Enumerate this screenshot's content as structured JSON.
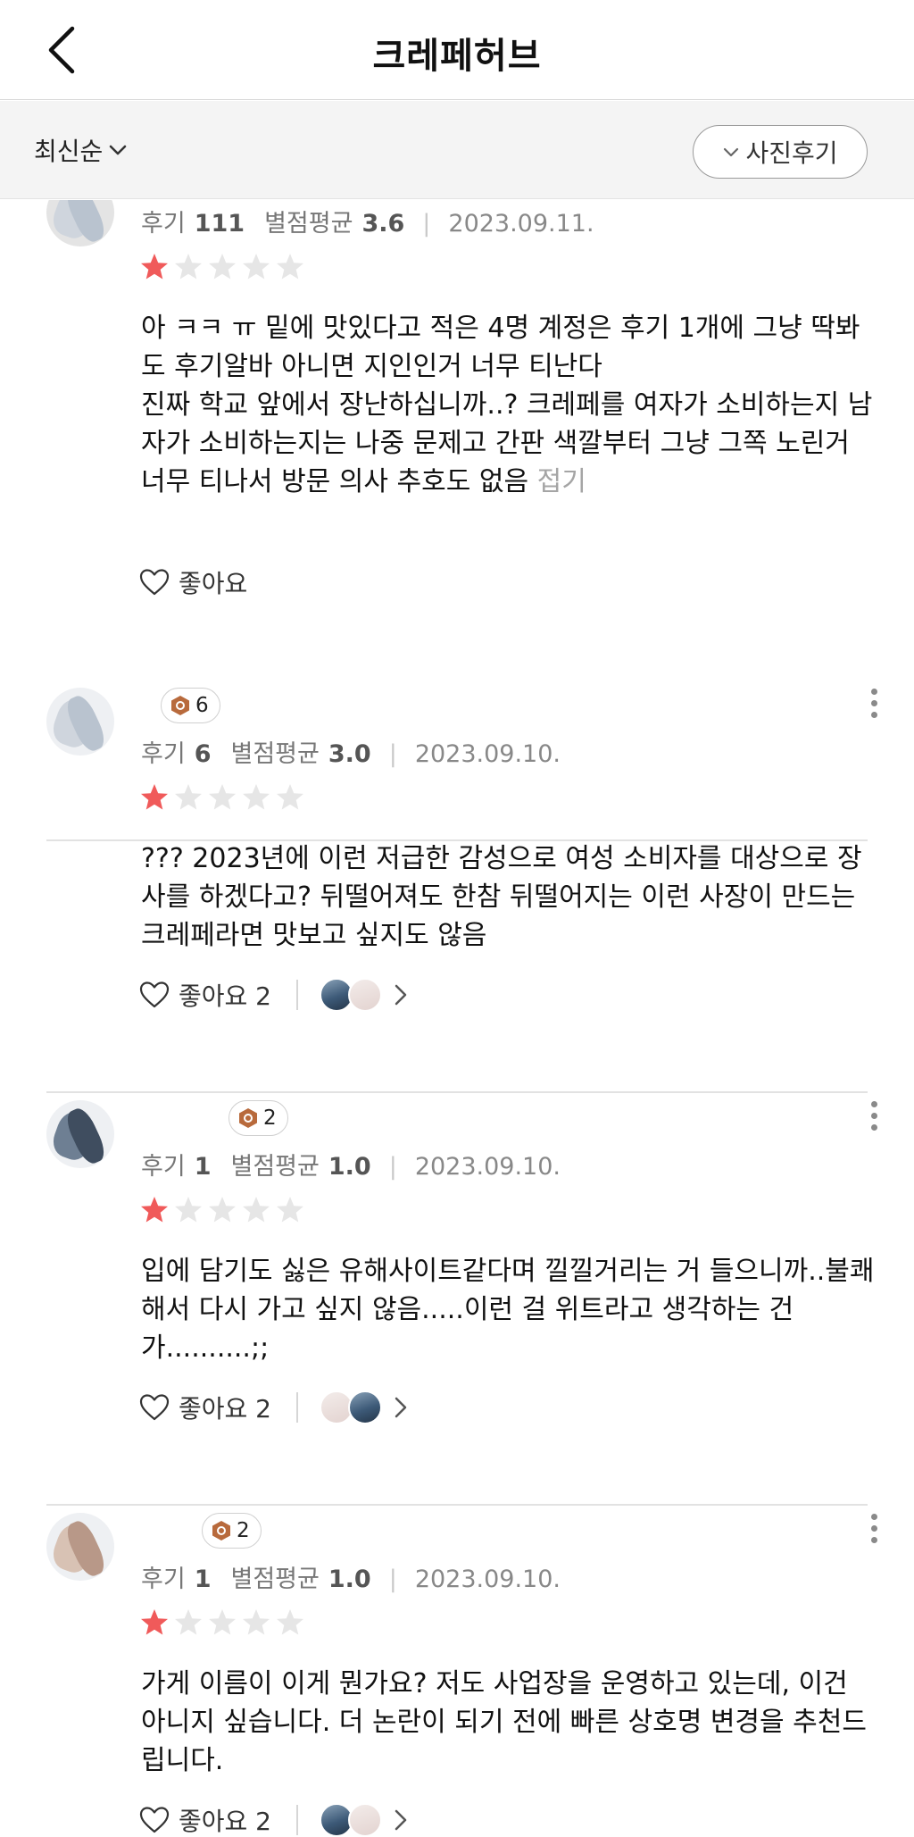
{
  "header": {
    "title": "크레페허브",
    "back_icon": "chevron-left-icon"
  },
  "filters": {
    "sort_label": "최신순",
    "photo_filter_label": "사진후기"
  },
  "labels": {
    "reviews_count": "후기",
    "rating_average": "별점평균",
    "like": "좋아요"
  },
  "colors": {
    "star_filled": "#f05a5a",
    "star_empty": "#e6e6e6",
    "badge_icon": "#b86a3c"
  },
  "reviews": [
    {
      "review_count": "111",
      "rating_avg": "3.6",
      "date": "2023.09.11.",
      "stars": 1,
      "text": "아 ㅋㅋ ㅠ 밑에 맛있다고 적은 4명 계정은 후기 1개에 그냥 딱봐도 후기알바 아니면 지인인거 너무 티난다\n진짜 학교 앞에서 장난하십니까..? 크레페를 여자가 소비하는지 남자가 소비하는지는 나중 문제고 간판 색깔부터 그냥 그쪽 노린거 너무 티나서 방문 의사 추호도 없음",
      "fold_label": "접기",
      "like_label": "좋아요",
      "like_count": ""
    },
    {
      "badge": "6",
      "review_count": "6",
      "rating_avg": "3.0",
      "date": "2023.09.10.",
      "stars": 1,
      "text": "??? 2023년에 이런 저급한 감성으로 여성 소비자를 대상으로 장사를 하겠다고? 뒤떨어져도 한참 뒤떨어지는 이런 사장이 만드는 크레페라면 맛보고 싶지도 않음",
      "like_label": "좋아요 2",
      "like_count": "2"
    },
    {
      "badge": "2",
      "review_count": "1",
      "rating_avg": "1.0",
      "date": "2023.09.10.",
      "stars": 1,
      "text": "입에 담기도 싫은 유해사이트같다며 낄낄거리는 거 들으니까..불쾌해서 다시 가고 싶지 않음.....이런 걸 위트라고 생각하는 건가..........;;",
      "like_label": "좋아요 2",
      "like_count": "2"
    },
    {
      "badge": "2",
      "review_count": "1",
      "rating_avg": "1.0",
      "date": "2023.09.10.",
      "stars": 1,
      "text": "가게 이름이 이게 뭔가요? 저도 사업장을 운영하고 있는데, 이건 아니지 싶습니다. 더 논란이 되기 전에 빠른 상호명 변경을 추천드립니다.",
      "like_label": "좋아요 2",
      "like_count": "2"
    }
  ]
}
